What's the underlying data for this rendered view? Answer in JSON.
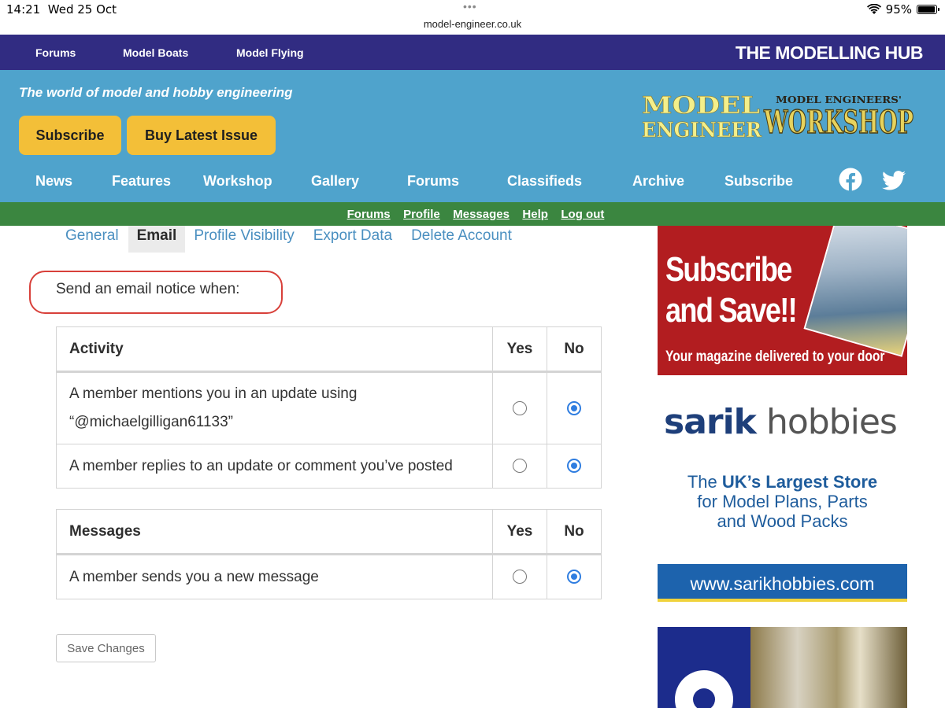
{
  "status_bar": {
    "time": "14:21",
    "date": "Wed 25 Oct",
    "url": "model-engineer.co.uk",
    "battery": "95%"
  },
  "top_nav": {
    "items": [
      "Forums",
      "Model Boats",
      "Model Flying"
    ],
    "hub_title": "THE MODELLING HUB"
  },
  "header": {
    "tagline": "The world of model and hobby engineering",
    "subscribe_label": "Subscribe",
    "buy_label": "Buy Latest Issue",
    "logo_model_engineer": "MODEL ENGINEER",
    "logo_workshop_small": "MODEL ENGINEERS'",
    "logo_workshop_big": "WORKSHOP"
  },
  "main_nav": {
    "items": [
      "News",
      "Features",
      "Workshop",
      "Gallery",
      "Forums",
      "Classifieds",
      "Archive",
      "Subscribe"
    ]
  },
  "user_bar": {
    "items": [
      "Forums",
      "Profile",
      "Messages",
      "Help",
      "Log out"
    ]
  },
  "tabs": {
    "items": [
      "General",
      "Email",
      "Profile Visibility",
      "Export Data",
      "Delete Account"
    ],
    "active": "Email"
  },
  "notice": "Send an email notice when:",
  "tables": {
    "activity": {
      "header": "Activity",
      "yes": "Yes",
      "no": "No",
      "rows": [
        {
          "line1": "A member mentions you in an update using",
          "line2": "“@michaelgilligan61133”",
          "selected": "no"
        },
        {
          "line1": "A member replies to an update or comment you’ve posted",
          "selected": "no"
        }
      ]
    },
    "messages": {
      "header": "Messages",
      "yes": "Yes",
      "no": "No",
      "rows": [
        {
          "line1": "A member sends you a new message",
          "selected": "no"
        }
      ]
    }
  },
  "save_label": "Save Changes",
  "ads": {
    "rcm": {
      "title_line1": "Subscribe",
      "title_line2": "and Save!!",
      "subtitle": "Your magazine delivered to your door"
    },
    "sarik": {
      "brand_bold": "sarik",
      "brand_light": "hobbies",
      "line1_prefix": "The ",
      "line1_bold": "UK’s Largest Store",
      "line2": "for Model Plans, Parts",
      "line3": "and Wood Packs",
      "url": "www.sarikhobbies.com"
    }
  },
  "colors": {
    "top_nav": "#312c82",
    "header": "#4fa3cc",
    "button_yellow": "#f3bf38",
    "user_bar": "#3b8640",
    "link_blue": "#4a8fc0",
    "radio_selected": "#2f7de0",
    "highlight_red": "#d8403a"
  }
}
